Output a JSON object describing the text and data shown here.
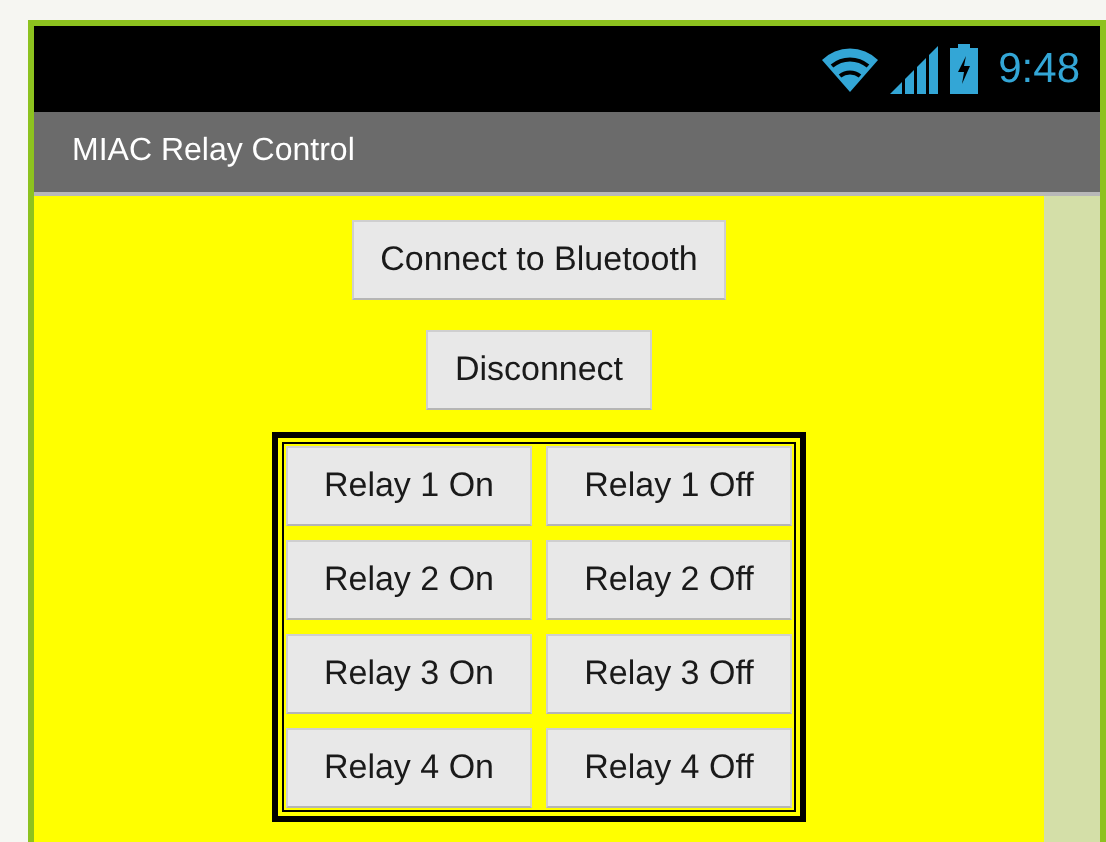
{
  "status_bar": {
    "time": "9:48"
  },
  "app_bar": {
    "title": "MIAC Relay Control"
  },
  "buttons": [
    "Connect to Bluetooth",
    "Disconnect"
  ],
  "relay_grid": [
    {
      "on_label": "Relay 1 On",
      "off_label": "Relay 1 Off"
    },
    {
      "on_label": "Relay 2 On",
      "off_label": "Relay 2 Off"
    },
    {
      "on_label": "Relay 3 On",
      "off_label": "Relay 3 Off"
    },
    {
      "on_label": "Relay 4 On",
      "off_label": "Relay 4 Off"
    }
  ]
}
